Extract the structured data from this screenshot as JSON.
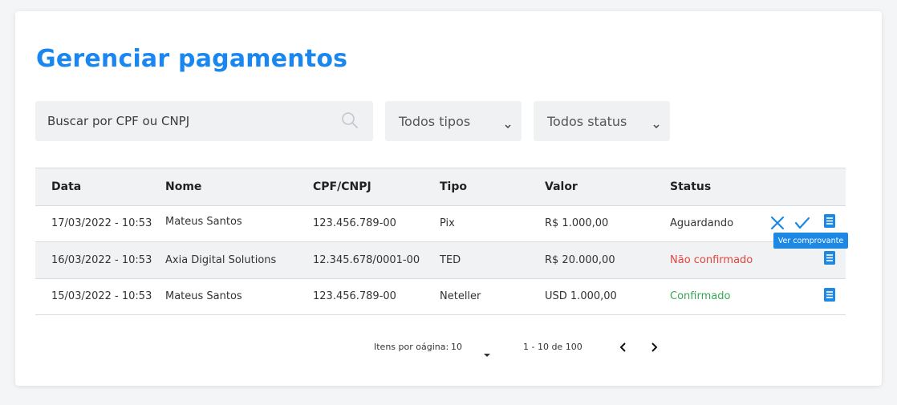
{
  "page": {
    "title": "Gerenciar pagamentos",
    "accent_color": "#1a87f0"
  },
  "filters": {
    "search_placeholder": "Buscar por CPF ou CNPJ",
    "search_icon": "search-icon",
    "type_select": "Todos tipos",
    "status_select": "Todos status"
  },
  "table": {
    "columns": [
      "Data",
      "Nome",
      "CPF/CNPJ",
      "Tipo",
      "Valor",
      "Status"
    ],
    "rows": [
      {
        "data": "17/03/2022 - 10:53",
        "nome": "Mateus Santos",
        "cpf": "123.456.789-00",
        "tipo": "Pix",
        "valor": "R$ 1.000,00",
        "status": "Aguardando",
        "status_color": "#333333",
        "actions": [
          "close-icon",
          "check-icon",
          "receipt-icon"
        ]
      },
      {
        "data": "16/03/2022 - 10:53",
        "nome": "Axia Digital Solutions",
        "cpf": "12.345.678/0001-00",
        "tipo": "TED",
        "valor": "R$ 20.000,00",
        "status": "Não confirmado",
        "status_color": "#e0463e",
        "actions": [
          "receipt-icon"
        ]
      },
      {
        "data": "15/03/2022 - 10:53",
        "nome": "Mateus Santos",
        "cpf": "123.456.789-00",
        "tipo": "Neteller",
        "valor": "USD 1.000,00",
        "status": "Confirmado",
        "status_color": "#3aa756",
        "actions": [
          "receipt-icon"
        ]
      }
    ]
  },
  "tooltip": {
    "text": "Ver comprovante"
  },
  "pagination": {
    "items_label": "Itens por oágina:",
    "items_value": "10",
    "range": "1 - 10 de 100"
  }
}
